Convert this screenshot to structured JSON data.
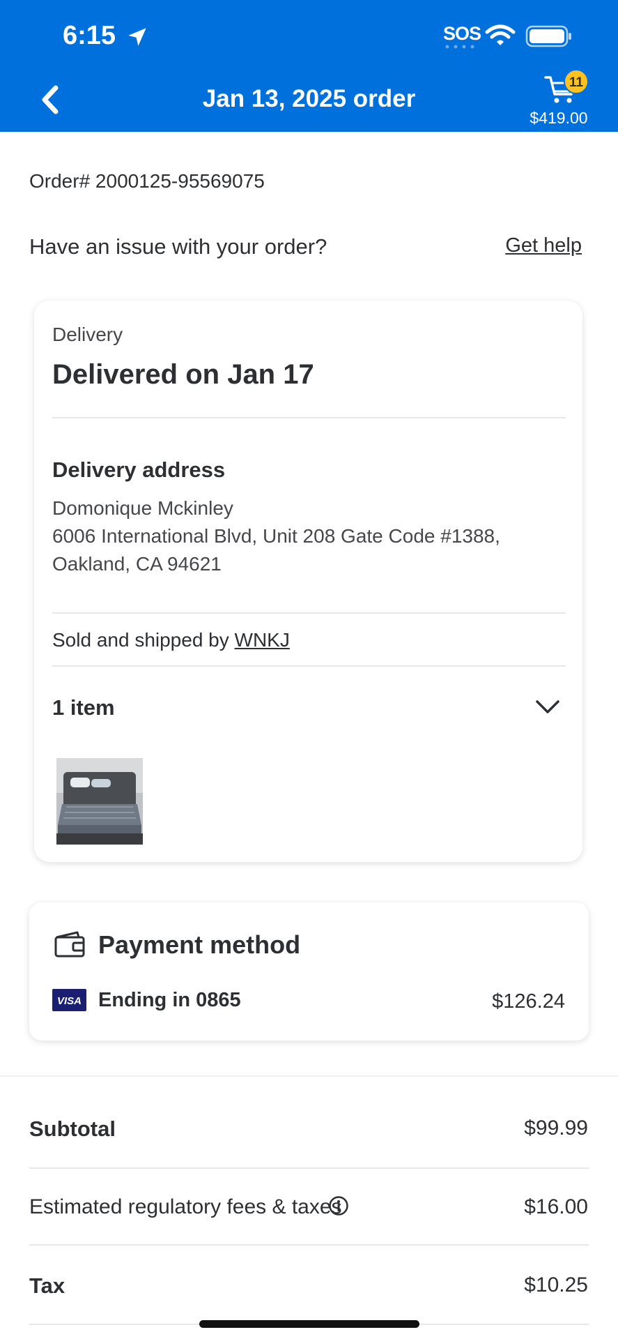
{
  "status_bar": {
    "time": "6:15",
    "sos": "SOS"
  },
  "header": {
    "title": "Jan 13, 2025 order",
    "cart_count": "11",
    "cart_total": "$419.00"
  },
  "order": {
    "number": "Order# 2000125-95569075",
    "issue_text": "Have an issue with your order?",
    "help_link": "Get help"
  },
  "delivery": {
    "label": "Delivery",
    "status": "Delivered on Jan 17",
    "address_heading": "Delivery address",
    "address_lines": [
      "Domonique Mckinley",
      "6006 International Blvd, Unit 208 Gate Code #1388,",
      "Oakland, CA 94621"
    ],
    "sold_by_prefix": "Sold and shipped by ",
    "seller": "WNKJ",
    "items_count": "1 item"
  },
  "payment": {
    "title": "Payment method",
    "card_ending": "Ending in 0865",
    "amount": "$126.24",
    "card_brand": "VISA"
  },
  "summary": {
    "subtotal_label": "Subtotal",
    "subtotal_value": "$99.99",
    "fees_label": "Estimated regulatory fees & taxes",
    "fees_value": "$16.00",
    "tax_label": "Tax",
    "tax_value": "$10.25"
  },
  "colors": {
    "brand_blue": "#0071dc",
    "badge_yellow": "#ffc220",
    "visa_blue": "#1a1f71"
  }
}
